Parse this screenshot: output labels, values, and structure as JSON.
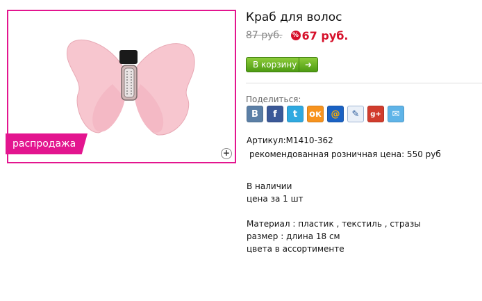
{
  "product": {
    "title": "Краб для волос",
    "old_price": "87 руб.",
    "discount_badge": "%",
    "new_price": "67 руб.",
    "sale_label": "распродажа",
    "zoom_icon": "plus-icon",
    "add_to_cart": "В корзину",
    "cart_arrow": "➜"
  },
  "share": {
    "label": "Поделиться:",
    "buttons": [
      {
        "icon": "vkontakte-icon",
        "glyph": "B"
      },
      {
        "icon": "facebook-icon",
        "glyph": "f"
      },
      {
        "icon": "twitter-icon",
        "glyph": "t"
      },
      {
        "icon": "odnoklassniki-icon",
        "glyph": "ок"
      },
      {
        "icon": "mailru-icon",
        "glyph": "@"
      },
      {
        "icon": "livejournal-icon",
        "glyph": "✎"
      },
      {
        "icon": "googleplus-icon",
        "glyph": "g+"
      },
      {
        "icon": "email-icon",
        "glyph": "✉"
      }
    ]
  },
  "details": {
    "article": "Артикул:M1410-362",
    "retail_price": "рекомендованная розничная цена:   550 руб",
    "availability": "В наличии",
    "unit_price": "цена за 1 шт",
    "material": "Материал : пластик , текстиль , стразы",
    "size": "размер : длина 18 см",
    "colors": "цвета в ассортименте"
  },
  "colors": {
    "accent": "#e3158f",
    "price_red": "#d6102a",
    "cart_green": "#5aa51a"
  }
}
